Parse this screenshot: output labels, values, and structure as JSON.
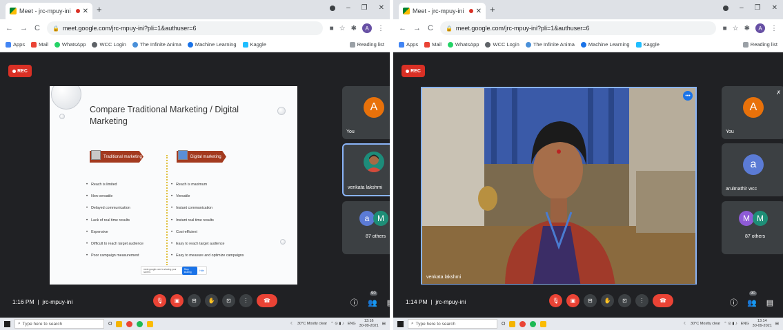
{
  "left": {
    "tab_title": "Meet - jrc-mpuy-ini",
    "url": "meet.google.com/jrc-mpuy-ini?pli=1&authuser=6",
    "profile_letter": "A",
    "bookmarks": [
      {
        "label": "Apps",
        "color": "#4285f4"
      },
      {
        "label": "Mail",
        "color": "#ea4335"
      },
      {
        "label": "WhatsApp",
        "color": "#25d366"
      },
      {
        "label": "WCC Login",
        "color": "#5f6368"
      },
      {
        "label": "The Infinite Anima",
        "color": "#4a90d9"
      },
      {
        "label": "Machine Learning",
        "color": "#1a73e8"
      },
      {
        "label": "Kaggle",
        "color": "#20beff"
      }
    ],
    "reading_list": "Reading list",
    "rec_label": "REC",
    "slide": {
      "title": "Compare Traditional Marketing / Digital Marketing",
      "traditional_header": "Traditional marketing",
      "digital_header": "Digital marketing",
      "traditional_points": [
        "Reach is limited",
        "Non-versatile",
        "Delayed communication",
        "Lack of real time results",
        "Expensive",
        "Difficult to reach target audience",
        "Poor campaign measurement"
      ],
      "digital_points": [
        "Reach is maximum",
        "Versatile",
        "Instant communication",
        "Instant real time results",
        "Cost-efficient",
        "Easy to reach target audience",
        "Easy to measure and optimize campaigns"
      ],
      "share_text": "meet.google.com is sharing your screen.",
      "stop_sharing": "Stop sharing",
      "hide": "Hide"
    },
    "tiles": [
      {
        "name": "You",
        "avatar": "A",
        "color": "#e8710a"
      },
      {
        "name": "venkata lakshmi",
        "avatar": "",
        "color": "#5f6368"
      },
      {
        "name": "87 others",
        "avatars": [
          "a",
          "M"
        ],
        "colors": [
          "#5b7bd5",
          "#1e8e77"
        ]
      }
    ],
    "time": "1:16 PM",
    "meeting_code": "jrc-mpuy-ini",
    "participant_count": "90",
    "taskbar_search": "Type here to search",
    "weather": "30°C Mostly clear",
    "lang": "ENG",
    "clock_time": "13:16",
    "clock_date": "30-09-2021"
  },
  "right": {
    "tab_title": "Meet - jrc-mpuy-ini",
    "url": "meet.google.com/jrc-mpuy-ini?pli=1&authuser=6",
    "profile_letter": "A",
    "bookmarks": [
      {
        "label": "Apps",
        "color": "#4285f4"
      },
      {
        "label": "Mail",
        "color": "#ea4335"
      },
      {
        "label": "WhatsApp",
        "color": "#25d366"
      },
      {
        "label": "WCC Login",
        "color": "#5f6368"
      },
      {
        "label": "The Infinite Anima",
        "color": "#4a90d9"
      },
      {
        "label": "Machine Learning",
        "color": "#1a73e8"
      },
      {
        "label": "Kaggle",
        "color": "#20beff"
      }
    ],
    "reading_list": "Reading list",
    "rec_label": "REC",
    "speaker_name": "venkata lakshmi",
    "tiles": [
      {
        "name": "You",
        "avatar": "A",
        "color": "#e8710a"
      },
      {
        "name": "arulmathir wcc",
        "avatar": "a",
        "color": "#5b7bd5"
      },
      {
        "name": "87 others",
        "avatars": [
          "M",
          "M"
        ],
        "colors": [
          "#8e5bd6",
          "#1e8e77"
        ]
      }
    ],
    "time": "1:14 PM",
    "meeting_code": "jrc-mpuy-ini",
    "participant_count": "90",
    "taskbar_search": "Type here to search",
    "weather": "30°C Mostly clear",
    "lang": "ENG",
    "clock_time": "13:14",
    "clock_date": "30-09-2021"
  },
  "colors": {
    "meet_bg": "#202124",
    "tile_bg": "#3c4043",
    "red": "#ea4335",
    "active_border": "#8ab4f8"
  }
}
